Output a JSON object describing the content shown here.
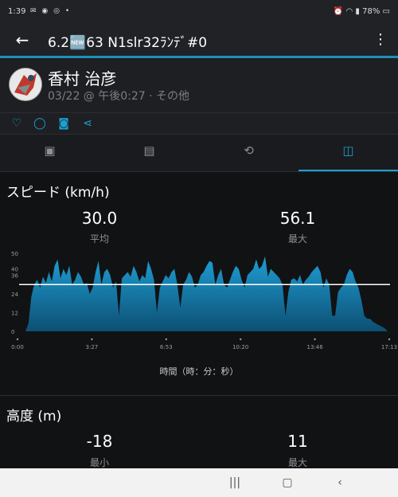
{
  "status_bar": {
    "time": "1:39",
    "notification_icons": [
      "mail-icon",
      "message-icon",
      "chat-icon",
      "dot-icon"
    ],
    "battery": "78%"
  },
  "app_bar": {
    "title": "6.2🆕63 N1slr32ﾗﾝﾃﾞ#0"
  },
  "profile": {
    "name": "香村 治彦",
    "meta": "03/22 @ 午後0:27 · その他"
  },
  "actions": [
    "like-icon",
    "comment-icon",
    "photo-icon",
    "share-icon"
  ],
  "tabs": [
    {
      "icon": "map-tab-icon",
      "glyph": "▣",
      "active": false
    },
    {
      "icon": "summary-tab-icon",
      "glyph": "▤",
      "active": false
    },
    {
      "icon": "laps-tab-icon",
      "glyph": "⟲",
      "active": false
    },
    {
      "icon": "charts-tab-icon",
      "glyph": "◫",
      "active": true
    }
  ],
  "speed": {
    "title": "スピード (km/h)",
    "avg_value": "30.0",
    "avg_label": "平均",
    "max_value": "56.1",
    "max_label": "最大"
  },
  "chart_data": {
    "type": "area",
    "title": "",
    "xlabel": "時間（時：分：秒）",
    "ylabel": "",
    "ylim": [
      0,
      50
    ],
    "yticks": [
      "50",
      "40",
      "36",
      "24",
      "12",
      "0"
    ],
    "x_tick_labels": [
      "0:00",
      "3:27",
      "6:53",
      "10:20",
      "13:46",
      "17:13"
    ],
    "avg_line": 30.0,
    "fill_color": "#1e9ed4",
    "series": [
      {
        "values": [
          0,
          5,
          22,
          30,
          33,
          28,
          35,
          31,
          38,
          32,
          42,
          46,
          34,
          40,
          36,
          42,
          30,
          33,
          38,
          35,
          30,
          31,
          24,
          28,
          38,
          45,
          30,
          38,
          40,
          36,
          28,
          32,
          10,
          34,
          36,
          38,
          35,
          42,
          38,
          32,
          36,
          34,
          45,
          40,
          33,
          12,
          28,
          32,
          36,
          34,
          38,
          40,
          30,
          15,
          30,
          33,
          38,
          35,
          28,
          30,
          36,
          38,
          42,
          45,
          44,
          30,
          36,
          40,
          30,
          28,
          33,
          38,
          42,
          40,
          33,
          28,
          36,
          38,
          40,
          46,
          40,
          42,
          48,
          35,
          40,
          38,
          36,
          34,
          30,
          10,
          25,
          33,
          34,
          32,
          36,
          30,
          33,
          35,
          38,
          40,
          42,
          38,
          28,
          34,
          30,
          10,
          10,
          25,
          28,
          30,
          36,
          40,
          38,
          32,
          28,
          20,
          10,
          8,
          8,
          6,
          5,
          4,
          3,
          2,
          0
        ]
      }
    ]
  },
  "elevation": {
    "title": "高度 (m)",
    "min_value": "-18",
    "min_label": "最小",
    "max_value": "11",
    "max_label": "最大"
  },
  "nav_bar": [
    "recents-button",
    "home-button",
    "back-button"
  ]
}
